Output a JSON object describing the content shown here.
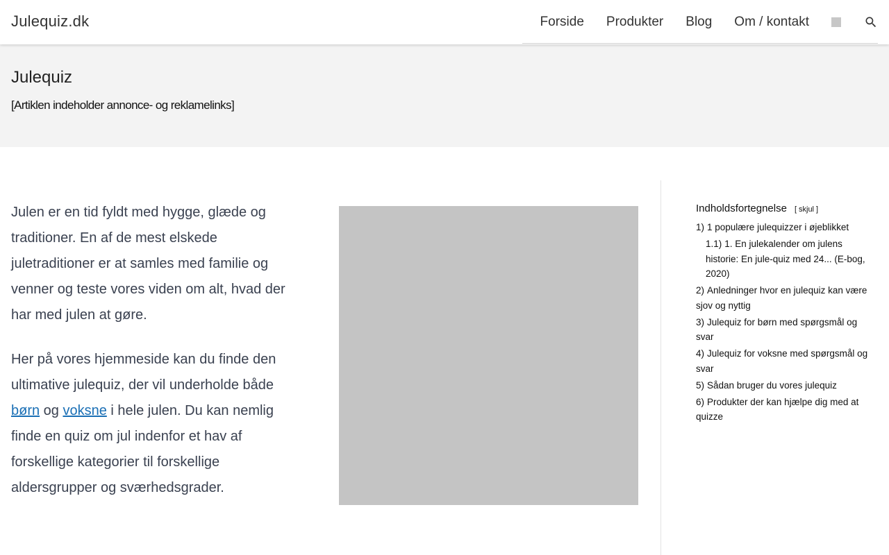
{
  "header": {
    "site_title": "Julequiz.dk",
    "nav": [
      "Forside",
      "Produkter",
      "Blog",
      "Om / kontakt"
    ],
    "icons": {
      "square": "image-placeholder-icon",
      "search": "search-icon"
    }
  },
  "page": {
    "title": "Julequiz",
    "disclaimer": "[Artiklen indeholder annonce- og reklamelinks]"
  },
  "content": {
    "para1": "Julen er en tid fyldt med hygge, glæde og traditioner. En af de mest elskede juletraditioner er at samles med familie og venner og teste vores viden om alt, hvad der har med julen at gøre.",
    "para2_start": "Her på vores hjemmeside kan du finde den ultimative julequiz, der vil underholde både ",
    "link_born": "børn",
    "para2_mid": " og ",
    "link_voksne": "voksne",
    "para2_end": " i hele julen. Du kan nemlig finde en quiz om jul indenfor et hav af forskellige kategorier til forskellige aldersgrupper og sværhedsgrader."
  },
  "toc": {
    "title": "Indholdsfortegnelse",
    "toggle": "skjul",
    "items": [
      {
        "num": "1)",
        "label": "1 populære julequizzer i øjeblikket"
      },
      {
        "num": "1.1)",
        "label": "1. En julekalender om julens historie: En jule-quiz med 24... (E-bog, 2020)"
      },
      {
        "num": "2)",
        "label": "Anledninger hvor en julequiz kan være sjov og nyttig"
      },
      {
        "num": "3)",
        "label": "Julequiz for børn med spørgsmål og svar"
      },
      {
        "num": "4)",
        "label": "Julequiz for voksne med spørgsmål og svar"
      },
      {
        "num": "5)",
        "label": "Sådan bruger du vores julequiz"
      },
      {
        "num": "6)",
        "label": "Produkter der kan hjælpe dig med at quizze"
      }
    ]
  },
  "colors": {
    "link": "#1a6fb5",
    "band": "#f3f3f3",
    "image_placeholder": "#c4c4c4",
    "body_text": "#3a4150"
  }
}
